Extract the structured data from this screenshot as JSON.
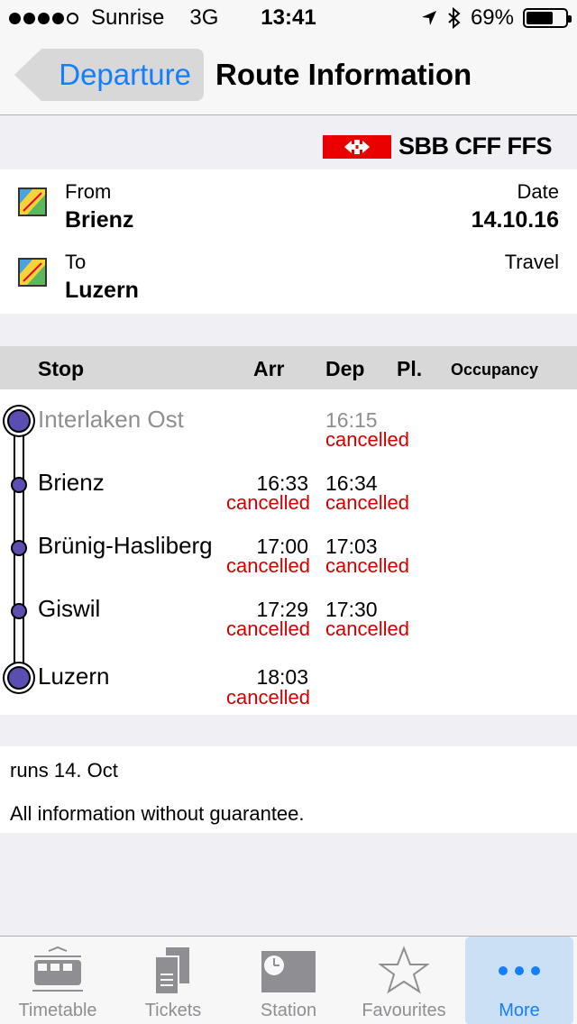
{
  "status_bar": {
    "carrier": "Sunrise",
    "network": "3G",
    "time": "13:41",
    "battery": "69%",
    "battery_level": 0.69
  },
  "nav": {
    "back_label": "Departure",
    "title": "Route Information"
  },
  "brand": "SBB CFF FFS",
  "route": {
    "from_label": "From",
    "from_value": "Brienz",
    "to_label": "To",
    "to_value": "Luzern",
    "date_label": "Date",
    "date_value": "14.10.16",
    "travel_label": "Travel"
  },
  "table": {
    "headers": {
      "stop": "Stop",
      "arr": "Arr",
      "dep": "Dep",
      "platform": "Pl.",
      "occupancy": "Occupancy"
    },
    "stops": [
      {
        "name": "Interlaken Ost",
        "arr": "",
        "arr_status": "",
        "dep": "16:15",
        "dep_status": "cancelled"
      },
      {
        "name": "Brienz",
        "arr": "16:33",
        "arr_status": "cancelled",
        "dep": "16:34",
        "dep_status": "cancelled"
      },
      {
        "name": "Brünig-Hasliberg",
        "arr": "17:00",
        "arr_status": "cancelled",
        "dep": "17:03",
        "dep_status": "cancelled"
      },
      {
        "name": "Giswil",
        "arr": "17:29",
        "arr_status": "cancelled",
        "dep": "17:30",
        "dep_status": "cancelled"
      },
      {
        "name": "Luzern",
        "arr": "18:03",
        "arr_status": "cancelled",
        "dep": "",
        "dep_status": ""
      }
    ]
  },
  "info": {
    "runs": "runs 14. Oct",
    "disclaimer": "All information without guarantee."
  },
  "tabs": [
    {
      "label": "Timetable",
      "icon": "train-icon"
    },
    {
      "label": "Tickets",
      "icon": "tickets-icon"
    },
    {
      "label": "Station",
      "icon": "station-clock-icon"
    },
    {
      "label": "Favourites",
      "icon": "star-icon"
    },
    {
      "label": "More",
      "icon": "more-dots-icon",
      "active": true
    }
  ],
  "colors": {
    "accent": "#147efb",
    "cancelled": "#d40000",
    "sbb_red": "#eb0000",
    "stop_dot": "#5a4eb0"
  }
}
